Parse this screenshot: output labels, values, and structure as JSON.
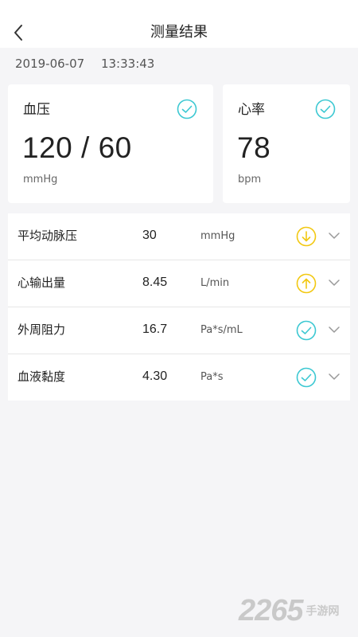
{
  "header": {
    "title": "测量结果"
  },
  "measurement": {
    "date": "2019-06-07",
    "time": "13:33:43"
  },
  "cards": {
    "blood_pressure": {
      "label": "血压",
      "value": "120 / 60",
      "unit": "mmHg",
      "status": "normal"
    },
    "heart_rate": {
      "label": "心率",
      "value": "78",
      "unit": "bpm",
      "status": "normal"
    }
  },
  "metrics": [
    {
      "name": "平均动脉压",
      "value": "30",
      "unit": "mmHg",
      "status": "low",
      "status_icon": "arrow-down-circle-icon"
    },
    {
      "name": "心输出量",
      "value": "8.45",
      "unit": "L/min",
      "status": "high",
      "status_icon": "arrow-up-circle-icon"
    },
    {
      "name": "外周阻力",
      "value": "16.7",
      "unit": "Pa*s/mL",
      "status": "normal",
      "status_icon": "check-circle-icon"
    },
    {
      "name": "血液黏度",
      "value": "4.30",
      "unit": "Pa*s",
      "status": "normal",
      "status_icon": "check-circle-icon"
    }
  ],
  "colors": {
    "normal": "#3cc8d2",
    "warning": "#f2c811",
    "background": "#f5f5f7"
  },
  "watermark": {
    "number": "2265",
    "text": "手游网"
  }
}
